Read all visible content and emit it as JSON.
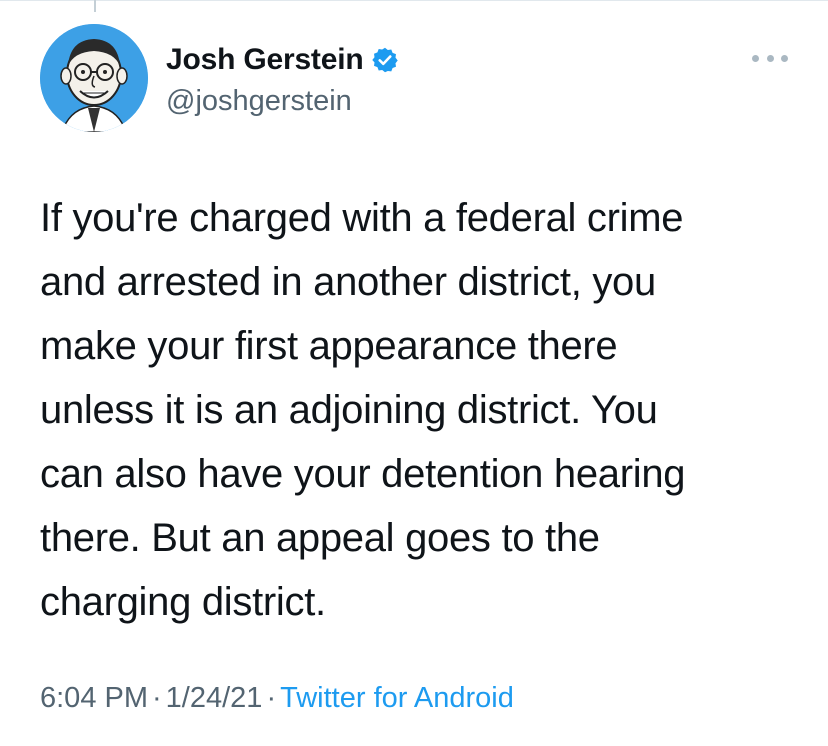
{
  "tweet": {
    "author": {
      "display_name": "Josh Gerstein",
      "handle": "@joshgerstein",
      "verified": true,
      "avatar_icon": "caricature-avatar-icon"
    },
    "text": "If you're charged with a federal crime\nand arrested in another district, you\nmake your first appearance there\nunless it is an adjoining district. You\ncan also have your detention hearing\nthere. But an appeal goes to the\ncharging district.",
    "time": "6:04 PM",
    "separator": "·",
    "date": "1/24/21",
    "source": "Twitter for Android"
  },
  "colors": {
    "accent": "#1d9bf0",
    "secondary_text": "#536471",
    "primary_text": "#0f1419",
    "avatar_bg": "#3da0e6"
  },
  "icons": {
    "verified": "verified-badge-icon",
    "more": "more-options-icon"
  }
}
